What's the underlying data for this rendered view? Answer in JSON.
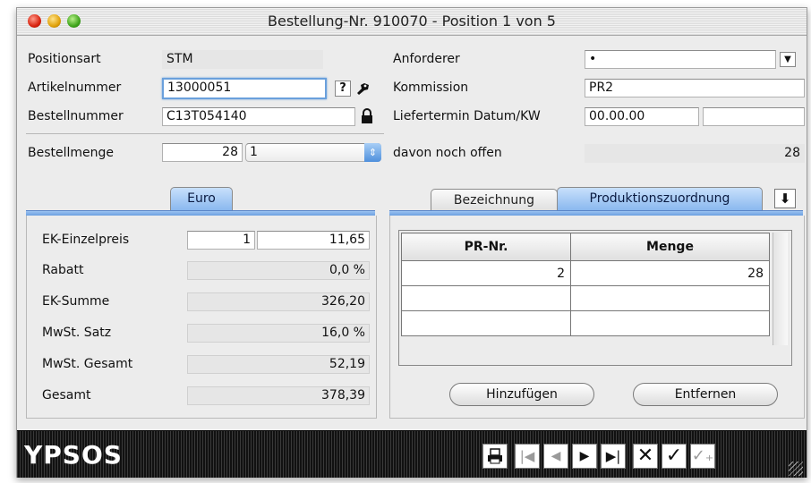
{
  "window": {
    "title": "Bestellung-Nr. 910070 - Position 1 von 5"
  },
  "header": {
    "positionsart": {
      "label": "Positionsart",
      "value": "STM"
    },
    "artikelnummer": {
      "label": "Artikelnummer",
      "value": "13000051",
      "help": "?"
    },
    "bestellnummer": {
      "label": "Bestellnummer",
      "value": "C13T054140"
    },
    "bestellmenge": {
      "label": "Bestellmenge",
      "value": "28",
      "unit": "1"
    },
    "anforderer": {
      "label": "Anforderer",
      "value": "•"
    },
    "kommission": {
      "label": "Kommission",
      "value": "PR2"
    },
    "liefertermin": {
      "label": "Liefertermin Datum/KW",
      "date": "00.00.00",
      "kw": ""
    },
    "offen": {
      "label": "davon noch offen",
      "value": "28"
    }
  },
  "euro_tab": {
    "label": "Euro"
  },
  "pricing": {
    "ek_einzelpreis": {
      "label": "EK-Einzelpreis",
      "qty": "1",
      "value": "11,65"
    },
    "rabatt": {
      "label": "Rabatt",
      "value": "0,0 %"
    },
    "ek_summe": {
      "label": "EK-Summe",
      "value": "326,20"
    },
    "mwst_satz": {
      "label": "MwSt. Satz",
      "value": "16,0 %"
    },
    "mwst_gesamt": {
      "label": "MwSt. Gesamt",
      "value": "52,19"
    },
    "gesamt": {
      "label": "Gesamt",
      "value": "378,39"
    }
  },
  "right_tabs": {
    "bezeichnung": "Bezeichnung",
    "produktion": "Produktionszuordnung"
  },
  "table": {
    "headers": [
      "PR-Nr.",
      "Menge"
    ],
    "rows": [
      [
        "2",
        "28"
      ],
      [
        "",
        ""
      ],
      [
        "",
        ""
      ]
    ]
  },
  "buttons": {
    "hinzufuegen": "Hinzufügen",
    "entfernen": "Entfernen"
  },
  "bottom": {
    "logo": "YPSOS"
  },
  "colors": {
    "accent": "#8ab8ef",
    "focus": "#6aa0dc",
    "bar": "#111111"
  }
}
